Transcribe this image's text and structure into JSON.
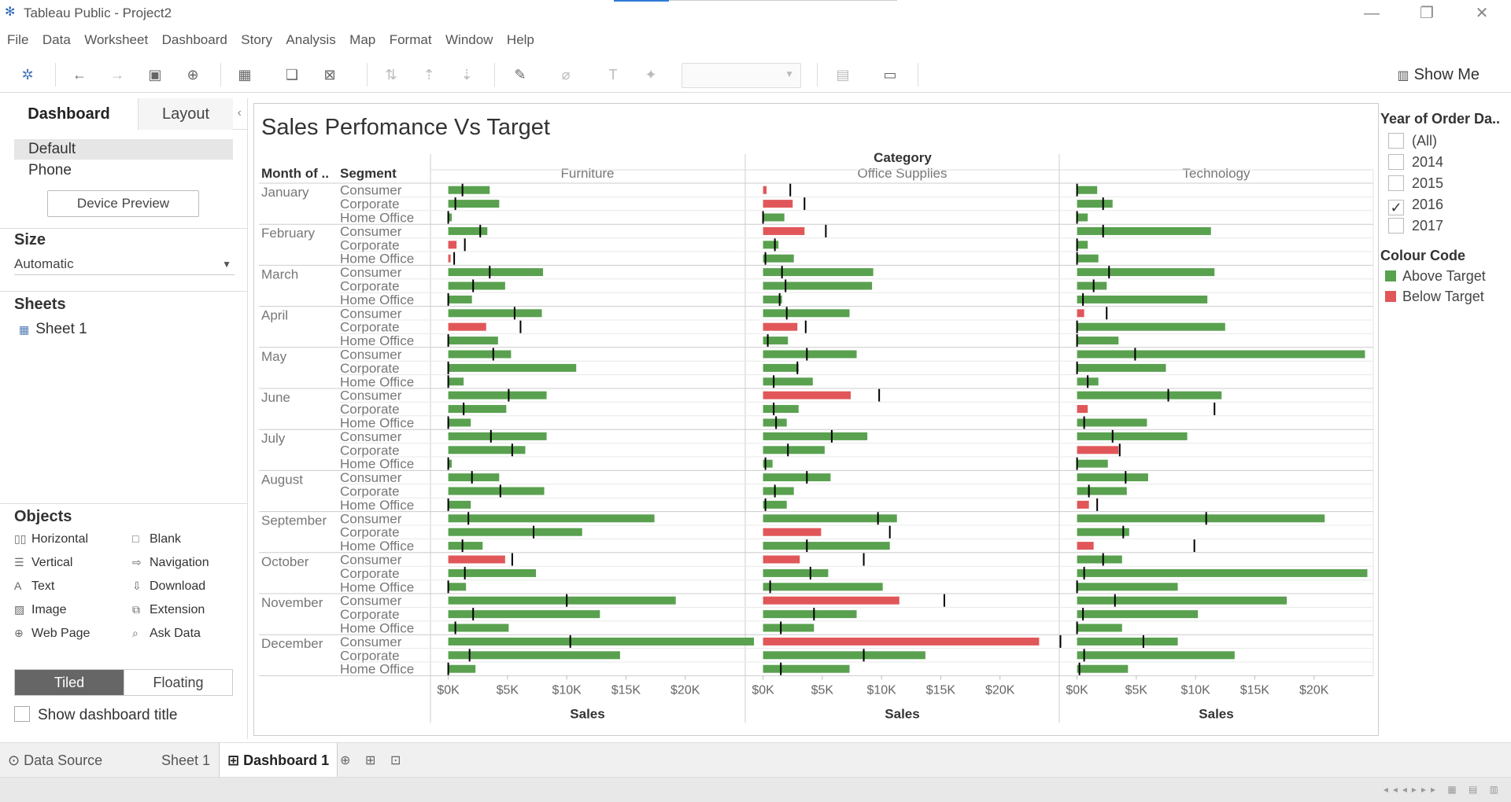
{
  "window": {
    "title": "Tableau Public - Project2",
    "controls": [
      "minimize-icon",
      "restore-icon",
      "close-icon"
    ]
  },
  "menu": [
    "File",
    "Data",
    "Worksheet",
    "Dashboard",
    "Story",
    "Analysis",
    "Map",
    "Format",
    "Window",
    "Help"
  ],
  "toolbar": {
    "show_me_label": "Show Me",
    "icons": [
      "tableau-logo-icon",
      "undo-icon",
      "redo-icon",
      "save-icon",
      "new-datasource-icon",
      "new-worksheet-icon",
      "duplicate-icon",
      "clear-icon",
      "swap-icon",
      "sort-asc-icon",
      "sort-desc-icon",
      "highlight-icon",
      "group-icon",
      "label-icon",
      "pin-icon",
      "fit-combo",
      "show-cards-icon",
      "presentation-icon"
    ]
  },
  "left_panel": {
    "tabs": [
      "Dashboard",
      "Layout"
    ],
    "device_items": [
      "Default",
      "Phone"
    ],
    "device_preview_label": "Device Preview",
    "size_heading": "Size",
    "size_value": "Automatic",
    "sheets_heading": "Sheets",
    "sheets": [
      "Sheet 1"
    ],
    "objects_heading": "Objects",
    "objects": [
      {
        "label": "Horizontal",
        "icon": "horizontal-icon"
      },
      {
        "label": "Blank",
        "icon": "blank-icon"
      },
      {
        "label": "Vertical",
        "icon": "vertical-icon"
      },
      {
        "label": "Navigation",
        "icon": "navigation-icon"
      },
      {
        "label": "Text",
        "icon": "text-icon"
      },
      {
        "label": "Download",
        "icon": "download-icon"
      },
      {
        "label": "Image",
        "icon": "image-icon"
      },
      {
        "label": "Extension",
        "icon": "extension-icon"
      },
      {
        "label": "Web Page",
        "icon": "web-page-icon"
      },
      {
        "label": "Ask Data",
        "icon": "ask-data-icon"
      }
    ],
    "tiled_label": "Tiled",
    "floating_label": "Floating",
    "show_title_label": "Show dashboard title"
  },
  "dashboard": {
    "title": "Sales Perfomance Vs Target"
  },
  "filter": {
    "title": "Year of Order Da..",
    "options": [
      {
        "label": "(All)",
        "checked": false
      },
      {
        "label": "2014",
        "checked": false
      },
      {
        "label": "2015",
        "checked": false
      },
      {
        "label": "2016",
        "checked": true
      },
      {
        "label": "2017",
        "checked": false
      }
    ]
  },
  "legend": {
    "title": "Colour Code",
    "items": [
      {
        "label": "Above Target",
        "color": "#59a14f"
      },
      {
        "label": "Below Target",
        "color": "#e15759"
      }
    ]
  },
  "chart_data": {
    "type": "bar",
    "orientation": "horizontal",
    "column_header": "Category",
    "row_headers": [
      "Month of ..",
      "Segment"
    ],
    "categories": [
      "Furniture",
      "Office Supplies",
      "Technology"
    ],
    "xlabel": "Sales",
    "xticks": [
      "$0K",
      "$5K",
      "$10K",
      "$15K",
      "$20K"
    ],
    "xlim": [
      -1500,
      25000
    ],
    "colors": {
      "above": "#59a14f",
      "below": "#e15759",
      "target": "#000000"
    },
    "months": [
      "January",
      "February",
      "March",
      "April",
      "May",
      "June",
      "July",
      "August",
      "September",
      "October",
      "November",
      "December"
    ],
    "segments": [
      "Consumer",
      "Corporate",
      "Home Office"
    ],
    "rows": [
      {
        "month": "January",
        "segment": "Consumer",
        "sales": [
          3500,
          300,
          1700
        ],
        "target": [
          1200,
          2300,
          0
        ]
      },
      {
        "month": "January",
        "segment": "Corporate",
        "sales": [
          4300,
          2500,
          3000
        ],
        "target": [
          600,
          3500,
          2200
        ]
      },
      {
        "month": "January",
        "segment": "Home Office",
        "sales": [
          300,
          1800,
          900
        ],
        "target": [
          0,
          0,
          0
        ]
      },
      {
        "month": "February",
        "segment": "Consumer",
        "sales": [
          3300,
          3500,
          11300
        ],
        "target": [
          2700,
          5300,
          2200
        ]
      },
      {
        "month": "February",
        "segment": "Corporate",
        "sales": [
          700,
          1300,
          900
        ],
        "target": [
          1400,
          1000,
          0
        ]
      },
      {
        "month": "February",
        "segment": "Home Office",
        "sales": [
          200,
          2600,
          1800
        ],
        "target": [
          500,
          200,
          0
        ]
      },
      {
        "month": "March",
        "segment": "Consumer",
        "sales": [
          8000,
          9300,
          11600
        ],
        "target": [
          3500,
          1600,
          2700
        ]
      },
      {
        "month": "March",
        "segment": "Corporate",
        "sales": [
          4800,
          9200,
          2500
        ],
        "target": [
          2100,
          1900,
          1400
        ]
      },
      {
        "month": "March",
        "segment": "Home Office",
        "sales": [
          2000,
          1600,
          11000
        ],
        "target": [
          0,
          1400,
          500
        ]
      },
      {
        "month": "April",
        "segment": "Consumer",
        "sales": [
          7900,
          7300,
          600
        ],
        "target": [
          5600,
          2000,
          2500
        ]
      },
      {
        "month": "April",
        "segment": "Corporate",
        "sales": [
          3200,
          2900,
          12500
        ],
        "target": [
          6100,
          3600,
          0
        ]
      },
      {
        "month": "April",
        "segment": "Home Office",
        "sales": [
          4200,
          2100,
          3500
        ],
        "target": [
          0,
          400,
          0
        ]
      },
      {
        "month": "May",
        "segment": "Consumer",
        "sales": [
          5300,
          7900,
          24300
        ],
        "target": [
          3800,
          3700,
          4900
        ]
      },
      {
        "month": "May",
        "segment": "Corporate",
        "sales": [
          10800,
          3000,
          7500
        ],
        "target": [
          0,
          2900,
          0
        ]
      },
      {
        "month": "May",
        "segment": "Home Office",
        "sales": [
          1300,
          4200,
          1800
        ],
        "target": [
          0,
          900,
          900
        ]
      },
      {
        "month": "June",
        "segment": "Consumer",
        "sales": [
          8300,
          7400,
          12200
        ],
        "target": [
          5100,
          9800,
          7700
        ]
      },
      {
        "month": "June",
        "segment": "Corporate",
        "sales": [
          4900,
          3000,
          900
        ],
        "target": [
          1300,
          900,
          11600
        ]
      },
      {
        "month": "June",
        "segment": "Home Office",
        "sales": [
          1900,
          2000,
          5900
        ],
        "target": [
          0,
          1100,
          600
        ]
      },
      {
        "month": "July",
        "segment": "Consumer",
        "sales": [
          8300,
          8800,
          9300
        ],
        "target": [
          3600,
          5800,
          3000
        ]
      },
      {
        "month": "July",
        "segment": "Corporate",
        "sales": [
          6500,
          5200,
          3500
        ],
        "target": [
          5400,
          2100,
          3600
        ]
      },
      {
        "month": "July",
        "segment": "Home Office",
        "sales": [
          300,
          800,
          2600
        ],
        "target": [
          0,
          200,
          0
        ]
      },
      {
        "month": "August",
        "segment": "Consumer",
        "sales": [
          4300,
          5700,
          6000
        ],
        "target": [
          2000,
          3700,
          4100
        ]
      },
      {
        "month": "August",
        "segment": "Corporate",
        "sales": [
          8100,
          2600,
          4200
        ],
        "target": [
          4400,
          1000,
          1000
        ]
      },
      {
        "month": "August",
        "segment": "Home Office",
        "sales": [
          1900,
          2000,
          1000
        ],
        "target": [
          0,
          200,
          1700
        ]
      },
      {
        "month": "September",
        "segment": "Consumer",
        "sales": [
          17400,
          11300,
          20900
        ],
        "target": [
          1700,
          9700,
          10900
        ]
      },
      {
        "month": "September",
        "segment": "Corporate",
        "sales": [
          11300,
          4900,
          4400
        ],
        "target": [
          7200,
          10700,
          3900
        ]
      },
      {
        "month": "September",
        "segment": "Home Office",
        "sales": [
          2900,
          10700,
          1400
        ],
        "target": [
          1200,
          3700,
          9900
        ]
      },
      {
        "month": "October",
        "segment": "Consumer",
        "sales": [
          4800,
          3100,
          3800
        ],
        "target": [
          5400,
          8500,
          2200
        ]
      },
      {
        "month": "October",
        "segment": "Corporate",
        "sales": [
          7400,
          5500,
          24500
        ],
        "target": [
          1400,
          4000,
          600
        ]
      },
      {
        "month": "October",
        "segment": "Home Office",
        "sales": [
          1500,
          10100,
          8500
        ],
        "target": [
          0,
          600,
          0
        ]
      },
      {
        "month": "November",
        "segment": "Consumer",
        "sales": [
          19200,
          11500,
          17700
        ],
        "target": [
          10000,
          15300,
          3200
        ]
      },
      {
        "month": "November",
        "segment": "Corporate",
        "sales": [
          12800,
          7900,
          10200
        ],
        "target": [
          2100,
          4300,
          500
        ]
      },
      {
        "month": "November",
        "segment": "Home Office",
        "sales": [
          5100,
          4300,
          3800
        ],
        "target": [
          600,
          1500,
          0
        ]
      },
      {
        "month": "December",
        "segment": "Consumer",
        "sales": [
          25800,
          23300,
          8500
        ],
        "target": [
          10300,
          25100,
          5600
        ]
      },
      {
        "month": "December",
        "segment": "Corporate",
        "sales": [
          14500,
          13700,
          13300
        ],
        "target": [
          1800,
          8500,
          600
        ]
      },
      {
        "month": "December",
        "segment": "Home Office",
        "sales": [
          2300,
          7300,
          4300
        ],
        "target": [
          0,
          1500,
          200
        ]
      }
    ]
  },
  "bottom_tabs": [
    "Data Source",
    "Sheet 1",
    "Dashboard 1"
  ],
  "active_tab": "Dashboard 1"
}
